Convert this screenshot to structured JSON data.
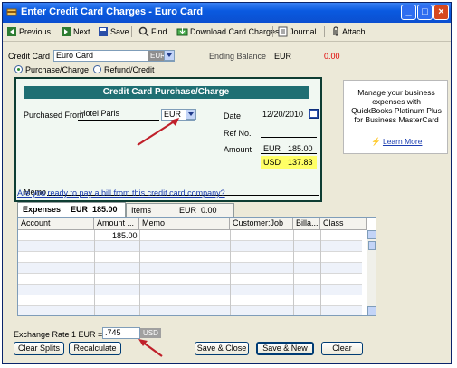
{
  "window": {
    "title": "Enter Credit Card Charges - Euro Card"
  },
  "toolbar": {
    "previous": "Previous",
    "next": "Next",
    "save": "Save",
    "find": "Find",
    "download": "Download Card Charges",
    "journal": "Journal",
    "attach": "Attach"
  },
  "header": {
    "credit_card_label": "Credit Card",
    "credit_card_value": "Euro Card",
    "currency_badge": "EUR",
    "ending_balance_label": "Ending Balance",
    "ending_balance_currency": "EUR",
    "ending_balance_value": "0.00",
    "purchase_label": "Purchase/Charge",
    "refund_label": "Refund/Credit"
  },
  "form": {
    "heading": "Credit Card Purchase/Charge",
    "purchased_from_label": "Purchased From",
    "purchased_from_value": "Hotel Paris",
    "vendor_currency": "EUR",
    "date_label": "Date",
    "date_value": "12/20/2010",
    "ref_label": "Ref No.",
    "amount_label": "Amount",
    "amount_currency": "EUR",
    "amount_value": "185.00",
    "usd_currency": "USD",
    "usd_value": "137.83",
    "memo_label": "Memo"
  },
  "ad": {
    "text": "Manage your business expenses with QuickBooks Platinum Plus for Business MasterCard",
    "link": "Learn More"
  },
  "pay_bill_link": "Are you ready to pay a bill from this credit card company?",
  "tabs": [
    {
      "label": "Expenses",
      "currency": "EUR",
      "amount": "185.00"
    },
    {
      "label": "Items",
      "currency": "EUR",
      "amount": "0.00"
    }
  ],
  "grid": {
    "columns": [
      "Account",
      "Amount ...",
      "Memo",
      "Customer:Job",
      "Billa...",
      "Class"
    ],
    "rows": [
      [
        "",
        "185.00",
        "",
        "",
        "",
        ""
      ]
    ]
  },
  "exchange": {
    "label": "Exchange Rate 1 EUR =",
    "value": ".745",
    "currency": "USD"
  },
  "buttons": {
    "clear_splits": "Clear Splits",
    "recalculate": "Recalculate",
    "save_close": "Save & Close",
    "save_new": "Save & New",
    "clear": "Clear"
  },
  "colors": {
    "title_bar": "#0a5ae0",
    "check_header": "#1f6f73",
    "usd_highlight": "#ffff66",
    "balance_red": "#e00000"
  }
}
